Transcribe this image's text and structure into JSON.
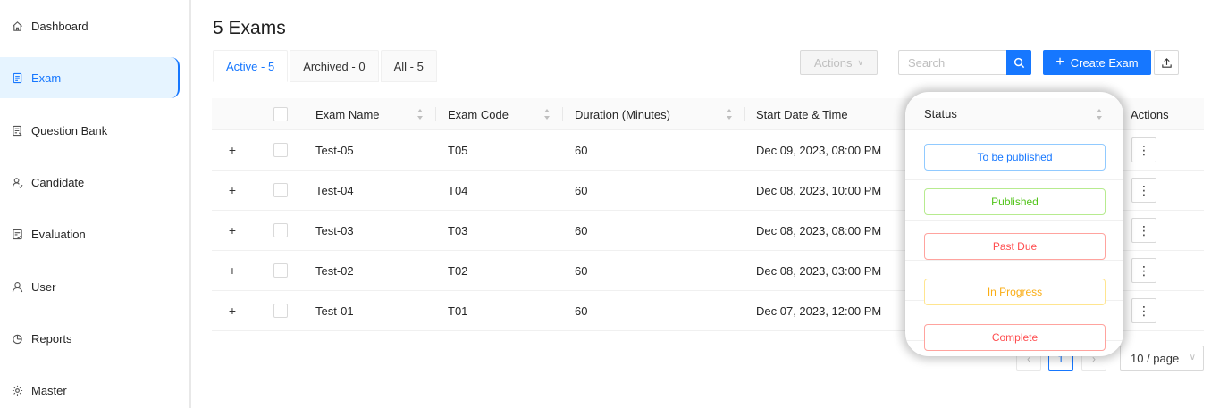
{
  "sidebar": {
    "items": [
      {
        "label": "Dashboard",
        "icon": "home-icon",
        "active": false
      },
      {
        "label": "Exam",
        "icon": "file-icon",
        "active": true
      },
      {
        "label": "Question Bank",
        "icon": "question-bank-icon",
        "active": false
      },
      {
        "label": "Candidate",
        "icon": "candidate-icon",
        "active": false
      },
      {
        "label": "Evaluation",
        "icon": "evaluation-icon",
        "active": false
      },
      {
        "label": "User",
        "icon": "user-icon",
        "active": false
      },
      {
        "label": "Reports",
        "icon": "pie-chart-icon",
        "active": false
      },
      {
        "label": "Master",
        "icon": "gear-icon",
        "active": false
      }
    ]
  },
  "main": {
    "title": "5 Exams",
    "tabs": [
      {
        "label": "Active - 5",
        "active": true
      },
      {
        "label": "Archived - 0",
        "active": false
      },
      {
        "label": "All - 5",
        "active": false
      }
    ],
    "actions_label": "Actions",
    "search_placeholder": "Search",
    "create_label": "Create Exam"
  },
  "table": {
    "columns": {
      "exam_name": "Exam Name",
      "exam_code": "Exam Code",
      "duration": "Duration (Minutes)",
      "start": "Start Date & Time",
      "status": "Status",
      "actions": "Actions"
    },
    "rows": [
      {
        "expand": "+",
        "name": "Test-05",
        "code": "T05",
        "duration": "60",
        "start": "Dec 09, 2023, 08:00 PM"
      },
      {
        "expand": "+",
        "name": "Test-04",
        "code": "T04",
        "duration": "60",
        "start": "Dec 08, 2023, 10:00 PM"
      },
      {
        "expand": "+",
        "name": "Test-03",
        "code": "T03",
        "duration": "60",
        "start": "Dec 08, 2023, 08:00 PM"
      },
      {
        "expand": "+",
        "name": "Test-02",
        "code": "T02",
        "duration": "60",
        "start": "Dec 08, 2023, 03:00 PM"
      },
      {
        "expand": "+",
        "name": "Test-01",
        "code": "T01",
        "duration": "60",
        "start": "Dec 07, 2023, 12:00 PM"
      }
    ],
    "more_glyph": "⋮"
  },
  "status_badges": [
    {
      "label": "To be published",
      "color": "#1677ff",
      "border": "#91caff"
    },
    {
      "label": "Published",
      "color": "#52c41a",
      "border": "#b7eb8f"
    },
    {
      "label": "Past Due",
      "color": "#ff4d4f",
      "border": "#ffa39e"
    },
    {
      "label": "In Progress",
      "color": "#faad14",
      "border": "#ffe58f"
    },
    {
      "label": "Complete",
      "color": "#ff4d4f",
      "border": "#ffa39e"
    }
  ],
  "pagination": {
    "current": "1",
    "page_size": "10 / page"
  }
}
